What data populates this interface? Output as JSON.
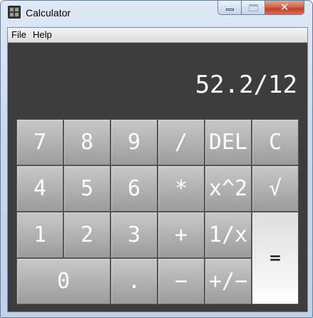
{
  "window": {
    "title": "Calculator",
    "app_icon": "calculator-icon",
    "controls": {
      "minimize_icon": "minimize-icon",
      "maximize_icon": "maximize-icon",
      "close_icon": "close-icon",
      "close_glyph": "✕"
    }
  },
  "menu": {
    "items": [
      "File",
      "Help"
    ]
  },
  "display": {
    "text": "52.2/12"
  },
  "keypad": {
    "rows": [
      [
        "7",
        "8",
        "9",
        "/",
        "DEL",
        "C"
      ],
      [
        "4",
        "5",
        "6",
        "*",
        "x^2",
        "√"
      ],
      [
        "1",
        "2",
        "3",
        "+",
        "1/x"
      ],
      [
        "0",
        ".",
        "−",
        "+/−"
      ]
    ],
    "equals": "="
  },
  "colors": {
    "display_bg": "#3d3d3d",
    "key_face": "#b2b2b2",
    "key_text": "#ffffff",
    "equals_face": "#efefef",
    "equals_text": "#000000"
  }
}
